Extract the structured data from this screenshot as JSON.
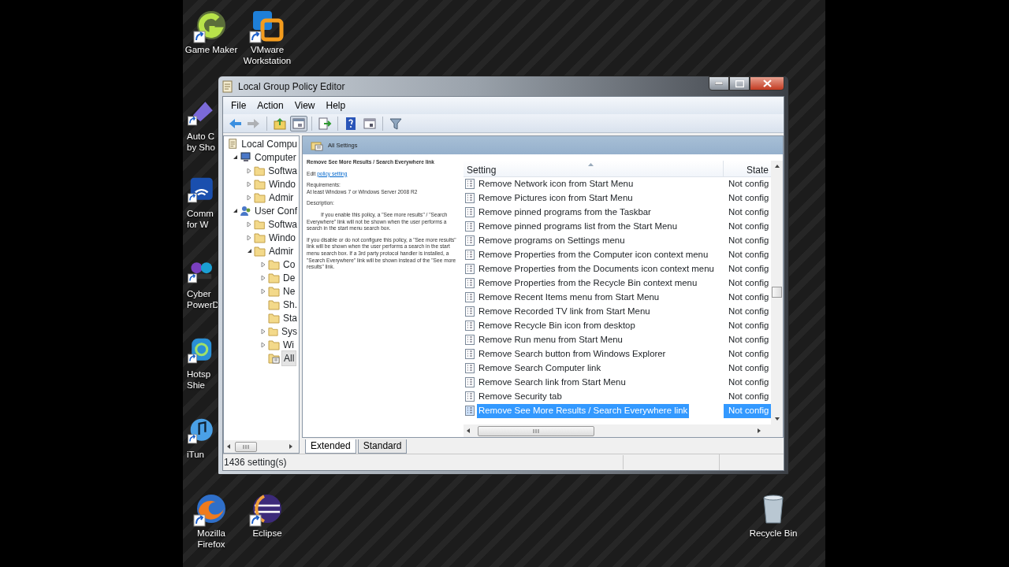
{
  "desktop_icons": [
    {
      "lines": [
        "Game Maker"
      ],
      "shortcut": true
    },
    {
      "lines": [
        "VMware",
        "Workstation"
      ],
      "shortcut": true
    },
    {
      "lines": [
        "Auto C",
        "by Sho"
      ],
      "shortcut": true
    },
    {
      "lines": [
        "Comm",
        "for W"
      ],
      "shortcut": true
    },
    {
      "lines": [
        "Cyber",
        "PowerD"
      ],
      "shortcut": true
    },
    {
      "lines": [
        "Hotsp",
        "Shie"
      ],
      "shortcut": true
    },
    {
      "lines": [
        "iTun"
      ],
      "shortcut": true
    },
    {
      "lines": [
        "Mozilla",
        "Firefox"
      ],
      "shortcut": true
    },
    {
      "lines": [
        "Eclipse"
      ],
      "shortcut": true
    },
    {
      "lines": [
        "Recycle Bin"
      ],
      "shortcut": false
    }
  ],
  "window": {
    "title": "Local Group Policy Editor"
  },
  "menu": [
    "File",
    "Action",
    "View",
    "Help"
  ],
  "toolbar": [
    {
      "kind": "back",
      "disabled": false,
      "pressed": false
    },
    {
      "kind": "forward",
      "disabled": true,
      "pressed": false
    },
    {
      "kind": "up",
      "disabled": false,
      "pressed": false
    },
    {
      "kind": "tree",
      "disabled": false,
      "pressed": true
    },
    {
      "kind": "export",
      "disabled": false,
      "pressed": false
    },
    {
      "kind": "help",
      "disabled": false,
      "pressed": false
    },
    {
      "kind": "properties",
      "disabled": false,
      "pressed": false
    },
    {
      "kind": "filter",
      "disabled": false,
      "pressed": false
    }
  ],
  "tree": [
    {
      "label": "Local Compu",
      "kind": "root",
      "selected": false,
      "children": [
        {
          "label": "Computer",
          "kind": "computer",
          "expanded": true,
          "selected": false,
          "children": [
            {
              "label": "Softwa",
              "kind": "folder",
              "expanded": false,
              "selected": false
            },
            {
              "label": "Windo",
              "kind": "folder",
              "expanded": false,
              "selected": false
            },
            {
              "label": "Admir",
              "kind": "folder",
              "expanded": false,
              "selected": false
            }
          ]
        },
        {
          "label": "User Conf",
          "kind": "user",
          "expanded": true,
          "selected": false,
          "children": [
            {
              "label": "Softwa",
              "kind": "folder",
              "expanded": false,
              "selected": false
            },
            {
              "label": "Windo",
              "kind": "folder",
              "expanded": false,
              "selected": false
            },
            {
              "label": "Admir",
              "kind": "folder",
              "expanded": true,
              "selected": false,
              "children": [
                {
                  "label": "Co",
                  "kind": "folder",
                  "expanded": false,
                  "selected": false
                },
                {
                  "label": "De",
                  "kind": "folder",
                  "expanded": false,
                  "selected": false
                },
                {
                  "label": "Ne",
                  "kind": "folder",
                  "expanded": false,
                  "selected": false
                },
                {
                  "label": "Sh.",
                  "kind": "folder",
                  "selected": false
                },
                {
                  "label": "Sta",
                  "kind": "folder",
                  "selected": false
                },
                {
                  "label": "Sys",
                  "kind": "folder",
                  "expanded": false,
                  "selected": false
                },
                {
                  "label": "Wi",
                  "kind": "folder",
                  "expanded": false,
                  "selected": false
                },
                {
                  "label": "All",
                  "kind": "all",
                  "selected": true
                }
              ]
            }
          ]
        }
      ]
    }
  ],
  "pane_header": "All Settings",
  "description": {
    "title": "Remove See More Results / Search Everywhere link",
    "edit_prefix": "Edit",
    "edit_link": "policy setting",
    "requirements_label": "Requirements:",
    "requirements": "At least Windows 7 or Windows Server 2008 R2",
    "description_label": "Description:",
    "paragraphs": [
      "If you enable this policy, a \"See more results\" / \"Search Everywhere\" link will not be shown when the user performs a search in the start menu search box.",
      "If you disable or do not configure this policy, a \"See more results\" link will be shown when the user performs a search in the start menu search box.  If a 3rd party protocol handler is installed, a \"Search Everywhere\" link will be shown instead of the \"See more results\" link."
    ]
  },
  "table": {
    "columns": [
      "Setting",
      "State"
    ],
    "rows": [
      {
        "setting": "Remove Network icon from Start Menu",
        "state": "Not config",
        "selected": false
      },
      {
        "setting": "Remove Pictures icon from Start Menu",
        "state": "Not config",
        "selected": false
      },
      {
        "setting": "Remove pinned programs from the Taskbar",
        "state": "Not config",
        "selected": false
      },
      {
        "setting": "Remove pinned programs list from the Start Menu",
        "state": "Not config",
        "selected": false
      },
      {
        "setting": "Remove programs on Settings menu",
        "state": "Not config",
        "selected": false
      },
      {
        "setting": "Remove Properties from the Computer icon context menu",
        "state": "Not config",
        "selected": false
      },
      {
        "setting": "Remove Properties from the Documents icon context menu",
        "state": "Not config",
        "selected": false
      },
      {
        "setting": "Remove Properties from the Recycle Bin context menu",
        "state": "Not config",
        "selected": false
      },
      {
        "setting": "Remove Recent Items menu from Start Menu",
        "state": "Not config",
        "selected": false
      },
      {
        "setting": "Remove Recorded TV link from Start Menu",
        "state": "Not config",
        "selected": false
      },
      {
        "setting": "Remove Recycle Bin icon from desktop",
        "state": "Not config",
        "selected": false
      },
      {
        "setting": "Remove Run menu from Start Menu",
        "state": "Not config",
        "selected": false
      },
      {
        "setting": "Remove Search button from Windows Explorer",
        "state": "Not config",
        "selected": false
      },
      {
        "setting": "Remove Search Computer link",
        "state": "Not config",
        "selected": false
      },
      {
        "setting": "Remove Search link from Start Menu",
        "state": "Not config",
        "selected": false
      },
      {
        "setting": "Remove Security tab",
        "state": "Not config",
        "selected": false
      },
      {
        "setting": "Remove See More Results / Search Everywhere link",
        "state": "Not config",
        "selected": true
      }
    ]
  },
  "view_tabs": [
    {
      "label": "Extended",
      "selected": true
    },
    {
      "label": "Standard",
      "selected": false
    }
  ],
  "status_bar": "1436 setting(s)"
}
